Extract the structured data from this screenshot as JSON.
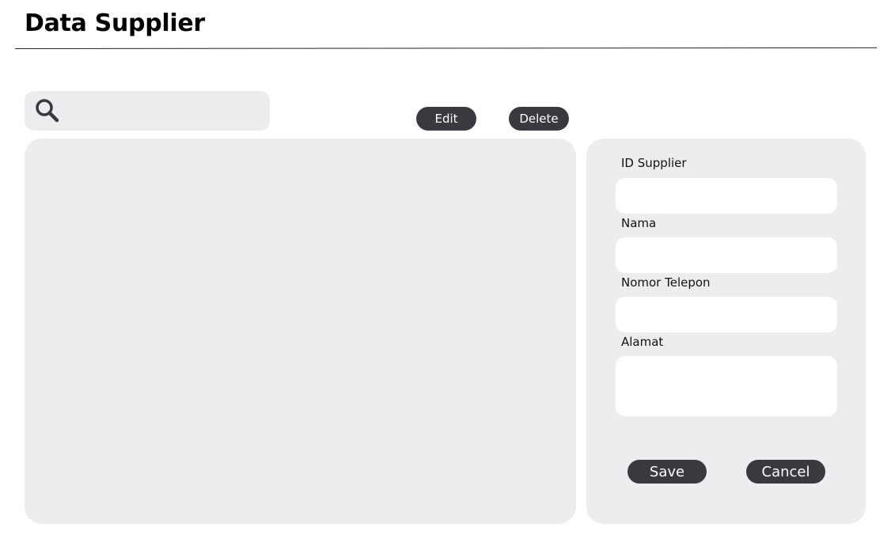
{
  "page": {
    "title": "Data Supplier"
  },
  "search": {
    "value": "",
    "placeholder": ""
  },
  "actions": {
    "edit_label": "Edit",
    "delete_label": "Delete"
  },
  "form": {
    "fields": [
      {
        "label": "ID Supplier",
        "value": ""
      },
      {
        "label": "Nama",
        "value": ""
      },
      {
        "label": "Nomor Telepon",
        "value": ""
      },
      {
        "label": "Alamat",
        "value": ""
      }
    ],
    "save_label": "Save",
    "cancel_label": "Cancel"
  },
  "colors": {
    "button_bg": "#3a393f",
    "panel_bg": "#ededef",
    "field_bg": "#ffffff"
  },
  "icons": {
    "search": "search-icon"
  }
}
